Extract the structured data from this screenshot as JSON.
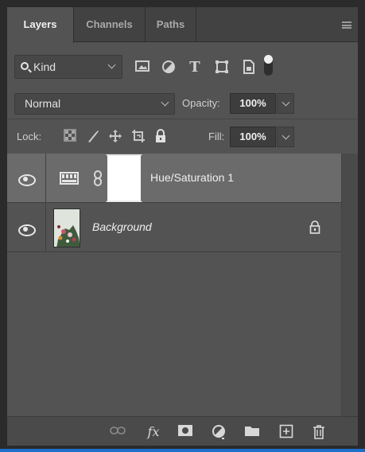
{
  "tabs": [
    {
      "label": "Layers",
      "active": true
    },
    {
      "label": "Channels",
      "active": false
    },
    {
      "label": "Paths",
      "active": false
    }
  ],
  "panel_menu_icon": "hamburger-icon",
  "filter": {
    "kind_label": "Kind",
    "icons": [
      "pixel-layer-filter-icon",
      "adjustment-layer-filter-icon",
      "type-layer-filter-icon",
      "shape-layer-filter-icon",
      "smart-object-filter-icon"
    ],
    "type_glyph": "T"
  },
  "blend": {
    "mode": "Normal",
    "opacity_label": "Opacity:",
    "opacity_value": "100%"
  },
  "lock": {
    "label": "Lock:",
    "icons": [
      "lock-transparent-pixels-icon",
      "lock-image-pixels-icon",
      "lock-position-icon",
      "lock-artboard-icon",
      "lock-all-icon"
    ],
    "fill_label": "Fill:",
    "fill_value": "100%"
  },
  "layers": [
    {
      "name": "Hue/Saturation 1",
      "type": "adjustment",
      "visible": true,
      "selected": true,
      "italic": false,
      "locked": false
    },
    {
      "name": "Background",
      "type": "pixel",
      "visible": true,
      "selected": false,
      "italic": true,
      "locked": true
    }
  ],
  "footer_icons": [
    "link-layers-icon",
    "fx-layer-style-icon",
    "add-mask-icon",
    "new-adjustment-layer-icon",
    "new-group-icon",
    "new-layer-icon",
    "delete-layer-icon"
  ],
  "footer_fx_text": "fx",
  "colors": {
    "panel": "#535353",
    "selected_row": "#6b6b6b",
    "tabbar": "#424242",
    "accent_strip": "#1e6fc9"
  }
}
